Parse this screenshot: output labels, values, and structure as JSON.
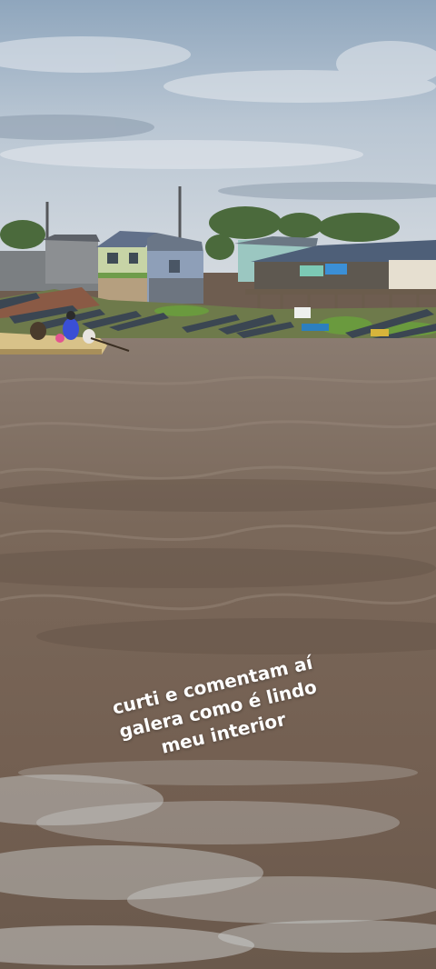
{
  "caption": {
    "line1": "curti e comentam aí",
    "line2": "galera como é lindo",
    "line3": "meu interior"
  }
}
